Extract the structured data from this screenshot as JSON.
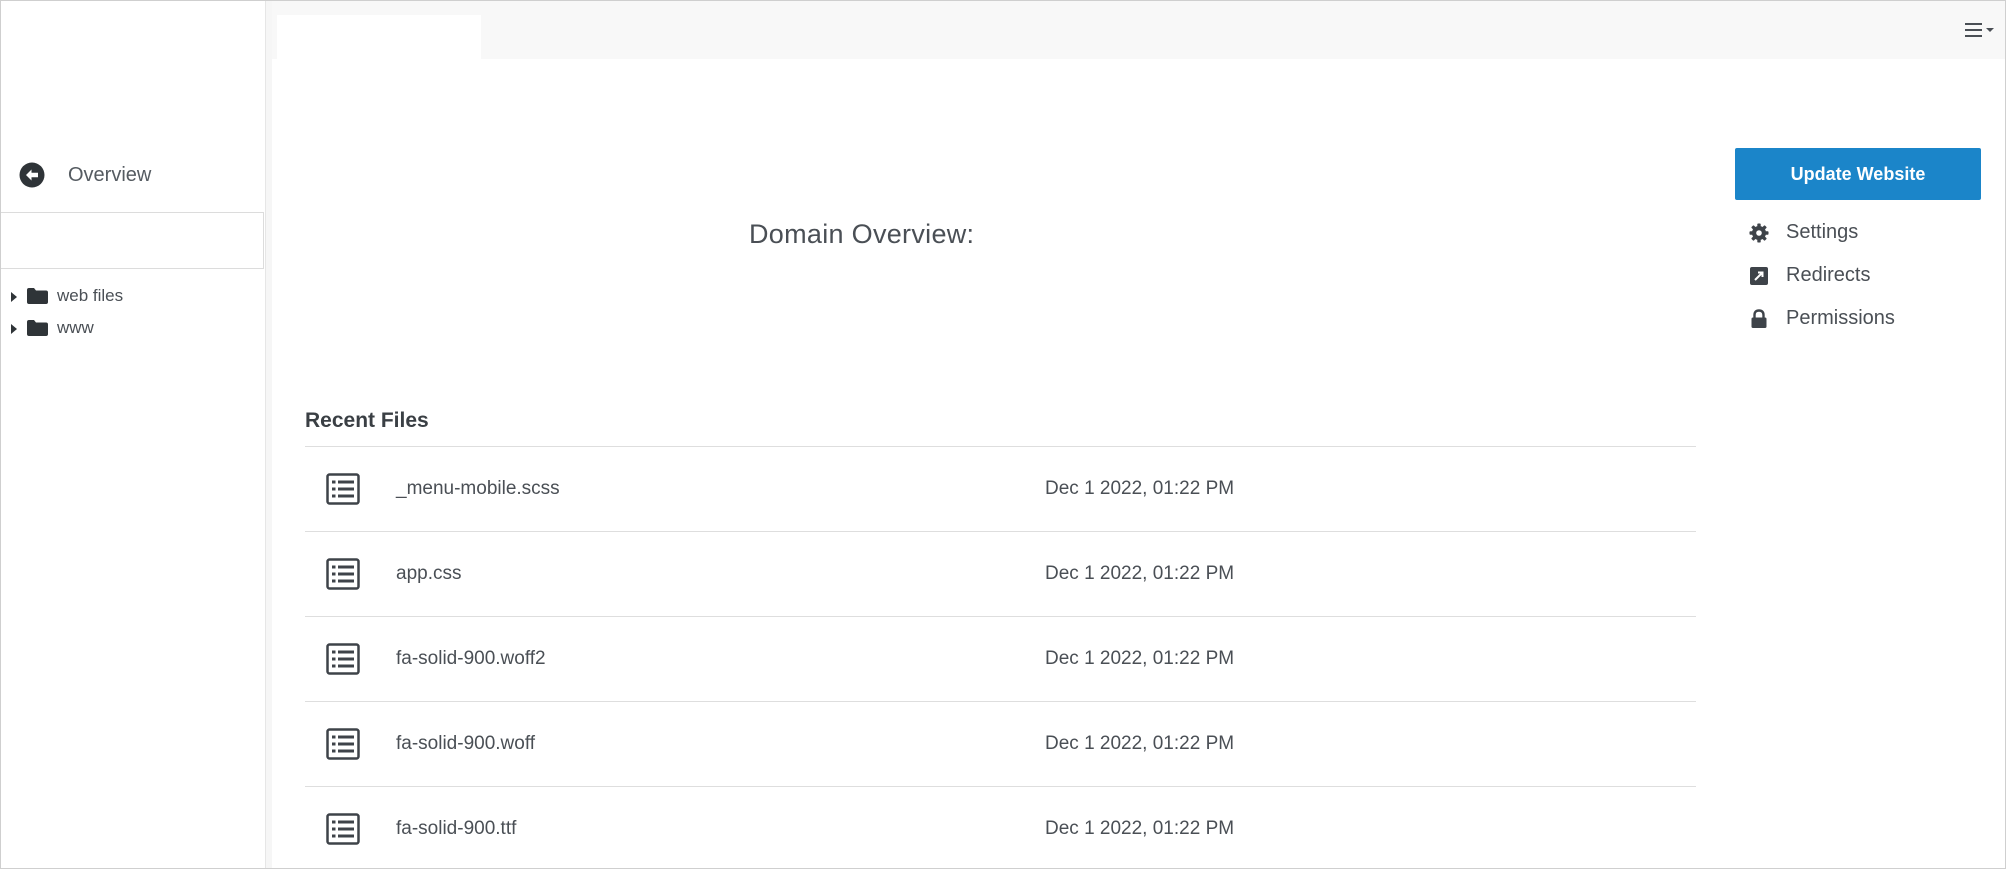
{
  "sidebar": {
    "back": {
      "label": "Overview",
      "icon": "arrow-circle-left-icon"
    },
    "tree": [
      {
        "label": "web files",
        "icon": "folder-icon"
      },
      {
        "label": "www",
        "icon": "folder-icon"
      }
    ]
  },
  "topbar": {
    "menu_icon": "hamburger-menu-icon"
  },
  "main": {
    "domain_title": "Domain Overview:",
    "recent_files": {
      "title": "Recent Files",
      "rows": [
        {
          "name": "_menu-mobile.scss",
          "date": "Dec 1 2022, 01:22 PM"
        },
        {
          "name": "app.css",
          "date": "Dec 1 2022, 01:22 PM"
        },
        {
          "name": "fa-solid-900.woff2",
          "date": "Dec 1 2022, 01:22 PM"
        },
        {
          "name": "fa-solid-900.woff",
          "date": "Dec 1 2022, 01:22 PM"
        },
        {
          "name": "fa-solid-900.ttf",
          "date": "Dec 1 2022, 01:22 PM"
        }
      ]
    }
  },
  "right_panel": {
    "update_button": "Update Website",
    "links": [
      {
        "label": "Settings",
        "icon": "gear-icon"
      },
      {
        "label": "Redirects",
        "icon": "redirect-icon"
      },
      {
        "label": "Permissions",
        "icon": "lock-icon"
      }
    ]
  },
  "colors": {
    "accent": "#1b85c9",
    "text": "#4a4f55",
    "icon": "#3e4349"
  }
}
